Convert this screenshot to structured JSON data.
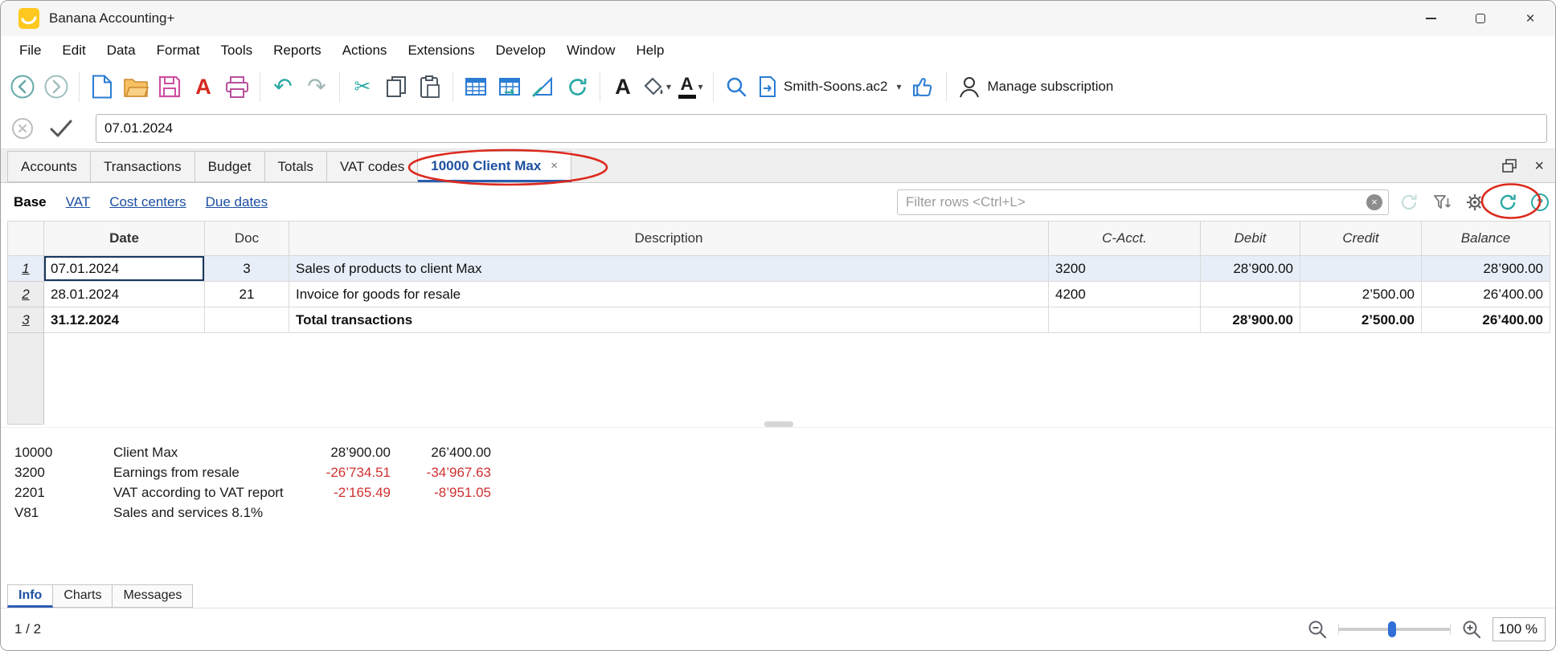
{
  "window": {
    "title": "Banana Accounting+"
  },
  "menu": {
    "items": [
      "File",
      "Edit",
      "Data",
      "Format",
      "Tools",
      "Reports",
      "Actions",
      "Extensions",
      "Develop",
      "Window",
      "Help"
    ]
  },
  "toolbar": {
    "file_name": "Smith-Soons.ac2",
    "subscription_label": "Manage subscription"
  },
  "formula_bar": {
    "value": "07.01.2024"
  },
  "tab_bar": {
    "tabs": [
      "Accounts",
      "Transactions",
      "Budget",
      "Totals",
      "VAT codes"
    ],
    "active_tab": "10000 Client Max"
  },
  "view_bar": {
    "views": [
      "Base",
      "VAT",
      "Cost centers",
      "Due dates"
    ],
    "active_view": "Base",
    "filter_placeholder": "Filter rows <Ctrl+L>"
  },
  "table": {
    "headers": {
      "date": "Date",
      "doc": "Doc",
      "description": "Description",
      "cacct": "C-Acct.",
      "debit": "Debit",
      "credit": "Credit",
      "balance": "Balance"
    },
    "rows": [
      {
        "num": "1",
        "date": "07.01.2024",
        "doc": "3",
        "description": "Sales of products to client Max",
        "cacct": "3200",
        "debit": "28’900.00",
        "credit": "",
        "balance": "28’900.00"
      },
      {
        "num": "2",
        "date": "28.01.2024",
        "doc": "21",
        "description": "Invoice for goods for resale",
        "cacct": "4200",
        "debit": "",
        "credit": "2’500.00",
        "balance": "26’400.00"
      },
      {
        "num": "3",
        "date": "31.12.2024",
        "doc": "",
        "description": "Total transactions",
        "cacct": "",
        "debit": "28’900.00",
        "credit": "2’500.00",
        "balance": "26’400.00"
      }
    ]
  },
  "info_panel": {
    "rows": [
      {
        "account": "10000",
        "description": "Client Max",
        "amount1": "28’900.00",
        "amount2": "26’400.00"
      },
      {
        "account": "3200",
        "description": "Earnings from resale",
        "amount1": "-26’734.51",
        "amount2": "-34’967.63"
      },
      {
        "account": "2201",
        "description": "VAT according to VAT report",
        "amount1": "-2’165.49",
        "amount2": "-8’951.05"
      },
      {
        "account": "V81",
        "description": "Sales and services 8.1%",
        "amount1": "",
        "amount2": ""
      }
    ]
  },
  "bottom_tabs": {
    "tabs": [
      "Info",
      "Charts",
      "Messages"
    ],
    "active": "Info"
  },
  "status_bar": {
    "position": "1 / 2",
    "zoom": "100 %"
  },
  "icons": {
    "undo": "↶",
    "redo": "↷",
    "cut": "✂",
    "dropdown": "▾",
    "close": "×",
    "help": "?",
    "font_letter": "A",
    "pdf_letter": "A",
    "clear": "×"
  },
  "colors": {
    "accent_blue": "#1d4fa1",
    "teal": "#2ba9a4",
    "negative_red": "#d03030",
    "selected_row": "#e7eef8",
    "annotation_red": "#dc2a1e"
  }
}
